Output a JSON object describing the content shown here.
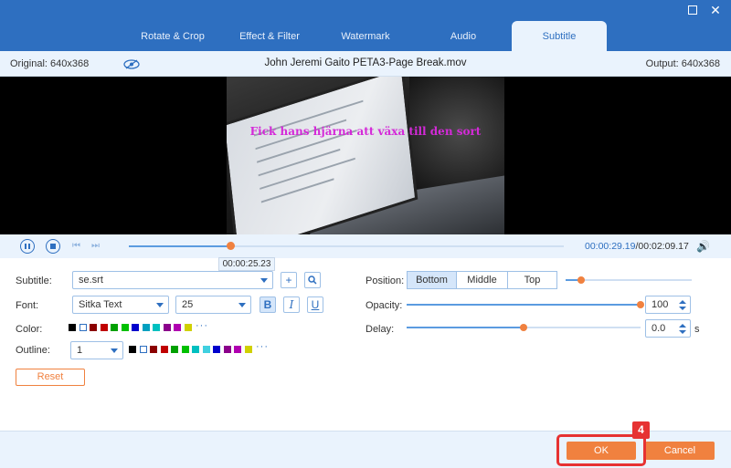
{
  "tabs": [
    {
      "label": "Rotate & Crop"
    },
    {
      "label": "Effect & Filter"
    },
    {
      "label": "Watermark"
    },
    {
      "label": "Audio"
    },
    {
      "label": "Subtitle",
      "active": true
    }
  ],
  "info": {
    "original": "Original: 640x368",
    "filename": "John Jeremi Gaito PETA3-Page Break.mov",
    "output": "Output: 640x368"
  },
  "video": {
    "subtitle_text": "Fick hans hjärna att växa till den sort"
  },
  "playback": {
    "progress": 0.233,
    "current_time": "00:00:29.19",
    "total_time": "/00:02:09.17",
    "tooltip_time": "00:00:25.23"
  },
  "subtitle_panel": {
    "subtitle_label": "Subtitle:",
    "subtitle_file": "se.srt",
    "font_label": "Font:",
    "font_name": "Sitka Text",
    "font_size": "25",
    "bold_label": "B",
    "italic_label": "I",
    "underline_label": "U",
    "color_label": "Color:",
    "outline_label": "Outline:",
    "outline_width": "1",
    "reset_label": "Reset",
    "more_dots": "···",
    "palette": [
      "#000000",
      "#ffffff",
      "#8b0000",
      "#c00000",
      "#00a000",
      "#00c000",
      "#0000cc",
      "#00a0c0",
      "#00c0c0",
      "#8b008b",
      "#b000b0",
      "#d0d000"
    ],
    "palette_outline": [
      "#000000",
      "#ffffff",
      "#8b0000",
      "#c00000",
      "#00a000",
      "#00c000",
      "#00c0c0",
      "#40d0e0",
      "#0000cc",
      "#8b008b",
      "#b000b0",
      "#d0d000"
    ]
  },
  "position_panel": {
    "position_label": "Position:",
    "bottom_label": "Bottom",
    "middle_label": "Middle",
    "top_label": "Top",
    "position_value": 0.12,
    "opacity_label": "Opacity:",
    "opacity_value": "100",
    "opacity_fraction": 1.0,
    "delay_label": "Delay:",
    "delay_value": "0.0",
    "delay_unit": "s",
    "delay_fraction": 0.5
  },
  "footer": {
    "ok_label": "OK",
    "cancel_label": "Cancel",
    "step_number": "4"
  },
  "colors": {
    "accent": "#2e6fc0",
    "orange": "#f0813f",
    "highlight": "#e63232",
    "subtitle_text": "#d42ad8"
  }
}
